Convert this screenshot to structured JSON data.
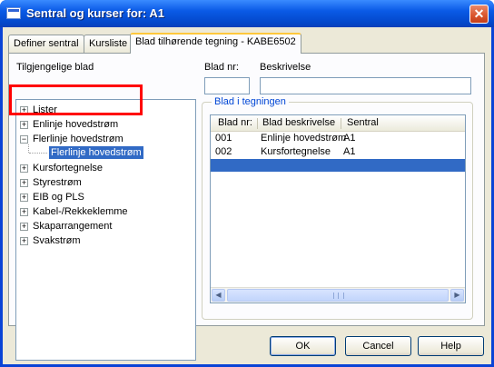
{
  "window": {
    "title": "Sentral og kurser for: A1",
    "close_symbol": "✕"
  },
  "tabs": [
    {
      "label": "Definer sentral"
    },
    {
      "label": "Kursliste"
    },
    {
      "label": "Blad tilhørende tegning - KABE6502"
    }
  ],
  "left": {
    "heading": "Tilgjengelige blad",
    "tree": [
      {
        "expander": "+",
        "label": "Lister"
      },
      {
        "expander": "+",
        "label": "Enlinje hovedstrøm"
      },
      {
        "expander": "−",
        "label": "Flerlinje hovedstrøm"
      },
      {
        "label": "Flerlinje hovedstrøm"
      },
      {
        "expander": "+",
        "label": "Kursfortegnelse"
      },
      {
        "expander": "+",
        "label": "Styrestrøm"
      },
      {
        "expander": "+",
        "label": "EIB og PLS"
      },
      {
        "expander": "+",
        "label": "Kabel-/Rekkeklemme"
      },
      {
        "expander": "+",
        "label": "Skaparrangement"
      },
      {
        "expander": "+",
        "label": "Svakstrøm"
      }
    ]
  },
  "right": {
    "blad_nr_label": "Blad nr:",
    "beskrivelse_label": "Beskrivelse",
    "blad_nr_value": "",
    "beskrivelse_value": "",
    "group_title": "Blad i tegningen",
    "columns": [
      "Blad nr:",
      "Blad beskrivelse",
      "Sentral"
    ],
    "rows": [
      [
        "001",
        "Enlinje hovedstrøm",
        "A1"
      ],
      [
        "002",
        "Kursfortegnelse",
        "A1"
      ]
    ]
  },
  "buttons": {
    "ok": "OK",
    "cancel": "Cancel",
    "help": "Help"
  },
  "colors": {
    "selection": "#316ac5",
    "annotation_border": "#ff0000",
    "title_bar": "#0a5ae6"
  }
}
